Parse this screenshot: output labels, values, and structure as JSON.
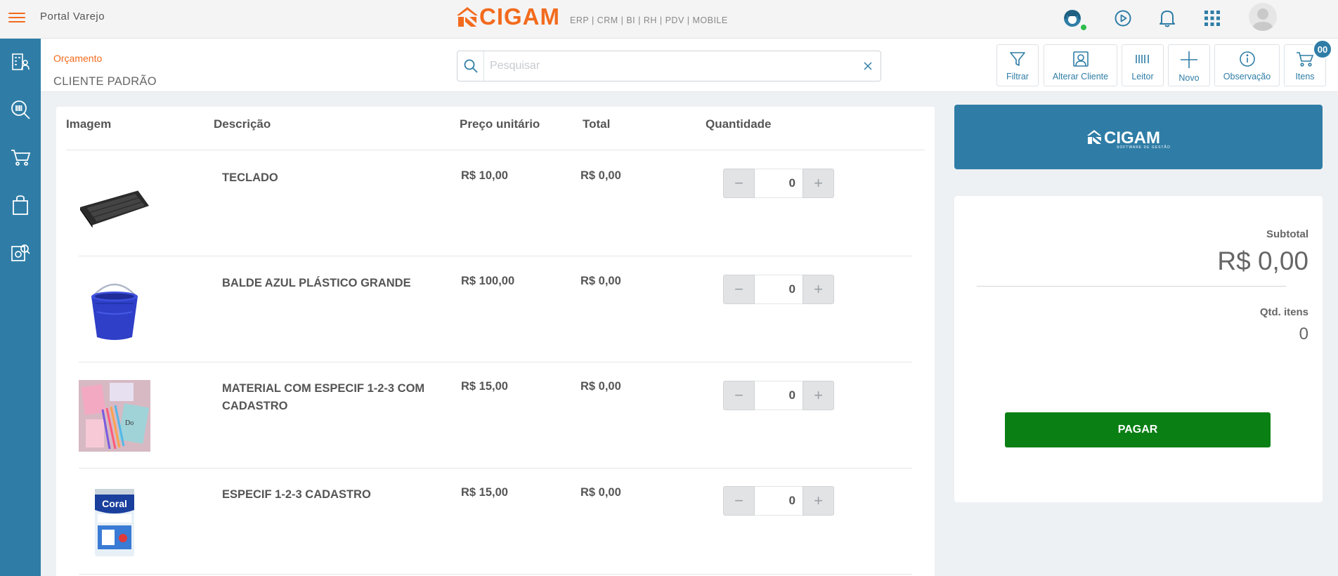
{
  "header": {
    "app_title": "Portal Varejo",
    "brand_name": "CIGAM",
    "brand_modules": "ERP | CRM | BI | RH | PDV | MOBILE",
    "icons": [
      "menu-icon",
      "support-agent-icon",
      "play-circle-icon",
      "bell-icon",
      "apps-grid-icon",
      "user-avatar"
    ]
  },
  "sidebar": {
    "items": [
      "clients-icon",
      "barcode-search-icon",
      "cart-icon",
      "shopping-bag-icon",
      "report-search-icon"
    ]
  },
  "subheader": {
    "breadcrumb": "Orçamento",
    "client": "CLIENTE PADRÃO",
    "search_placeholder": "Pesquisar",
    "tools": {
      "filter": "Filtrar",
      "change_client": "Alterar Cliente",
      "reader": "Leitor",
      "new": "Novo",
      "note": "Observação",
      "items": "Itens"
    },
    "cart_badge": "00"
  },
  "table": {
    "headers": {
      "image": "Imagem",
      "description": "Descrição",
      "unit_price": "Preço unitário",
      "total": "Total",
      "quantity": "Quantidade"
    },
    "rows": [
      {
        "description": "TECLADO",
        "unit_price": "R$ 10,00",
        "total": "R$ 0,00",
        "quantity": "0",
        "image": "keyboard"
      },
      {
        "description": "BALDE AZUL PLÁSTICO GRANDE",
        "unit_price": "R$ 100,00",
        "total": "R$ 0,00",
        "quantity": "0",
        "image": "blue-bucket"
      },
      {
        "description": "MATERIAL COM ESPECIF 1-2-3 COM CADASTRO",
        "unit_price": "R$ 15,00",
        "total": "R$ 0,00",
        "quantity": "0",
        "image": "stationery-set"
      },
      {
        "description": "ESPECIF 1-2-3 CADASTRO",
        "unit_price": "R$ 15,00",
        "total": "R$ 0,00",
        "quantity": "0",
        "image": "paint-can"
      }
    ]
  },
  "summary": {
    "logo_text": "CIGAM",
    "logo_tagline": "SOFTWARE DE GESTÃO",
    "subtotal_label": "Subtotal",
    "subtotal_value": "R$ 0,00",
    "qty_label": "Qtd. itens",
    "qty_value": "0",
    "pay_label": "PAGAR"
  },
  "colors": {
    "accent": "#f26b1d",
    "primary": "#2f7da6",
    "pay": "#0a7f14"
  }
}
